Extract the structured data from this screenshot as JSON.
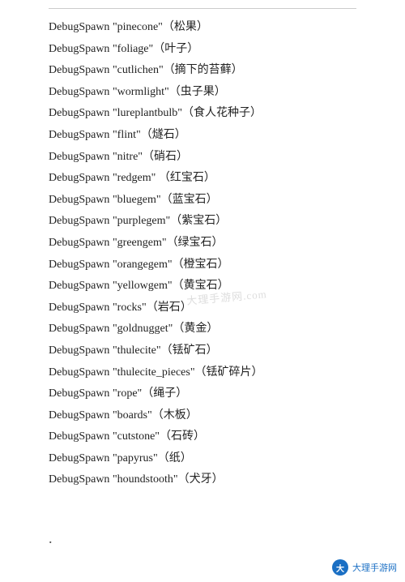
{
  "divider": true,
  "items": [
    {
      "keyword": "DebugSpawn",
      "name": "\"pinecone\"",
      "cn": "（松果）"
    },
    {
      "keyword": "DebugSpawn",
      "name": "\"foliage\"",
      "cn": "（叶子）"
    },
    {
      "keyword": "DebugSpawn",
      "name": "\"cutlichen\"",
      "cn": "（摘下的苔藓）"
    },
    {
      "keyword": "DebugSpawn",
      "name": "\"wormlight\"",
      "cn": "（虫子果）"
    },
    {
      "keyword": "DebugSpawn",
      "name": "\"lureplantbulb\"",
      "cn": "（食人花种子）"
    },
    {
      "keyword": "DebugSpawn",
      "name": "\"flint\"",
      "cn": "（燧石）"
    },
    {
      "keyword": "DebugSpawn",
      "name": "\"nitre\"",
      "cn": "（硝石）"
    },
    {
      "keyword": "DebugSpawn",
      "name": "\"redgem\"",
      "cn": "  （红宝石）"
    },
    {
      "keyword": "DebugSpawn",
      "name": "\"bluegem\"",
      "cn": "（蓝宝石）"
    },
    {
      "keyword": "DebugSpawn",
      "name": "\"purplegem\"",
      "cn": "（紫宝石）"
    },
    {
      "keyword": "DebugSpawn",
      "name": "\"greengem\"",
      "cn": "（绿宝石）"
    },
    {
      "keyword": "DebugSpawn",
      "name": "\"orangegem\"",
      "cn": "（橙宝石）"
    },
    {
      "keyword": "DebugSpawn",
      "name": "\"yellowgem\"",
      "cn": "（黄宝石）"
    },
    {
      "keyword": "DebugSpawn",
      "name": "\"rocks\"",
      "cn": "（岩石）"
    },
    {
      "keyword": "DebugSpawn",
      "name": "\"goldnugget\"",
      "cn": "（黄金）"
    },
    {
      "keyword": "DebugSpawn",
      "name": "\"thulecite\"",
      "cn": "（铥矿石）"
    },
    {
      "keyword": "DebugSpawn",
      "name": "\"thulecite_pieces\"",
      "cn": "（铥矿碎片）"
    },
    {
      "keyword": "DebugSpawn",
      "name": "\"rope\"",
      "cn": "（绳子）"
    },
    {
      "keyword": "DebugSpawn",
      "name": "\"boards\"",
      "cn": "（木板）"
    },
    {
      "keyword": "DebugSpawn",
      "name": "\"cutstone\"",
      "cn": "（石砖）"
    },
    {
      "keyword": "DebugSpawn",
      "name": "\"papyrus\"",
      "cn": "（纸）"
    },
    {
      "keyword": "DebugSpawn",
      "name": "\"houndstooth\"",
      "cn": "（犬牙）"
    }
  ],
  "dot": ".",
  "watermark": "大理手游网.com",
  "footer": {
    "logo": "大",
    "text": "大理手游网"
  }
}
